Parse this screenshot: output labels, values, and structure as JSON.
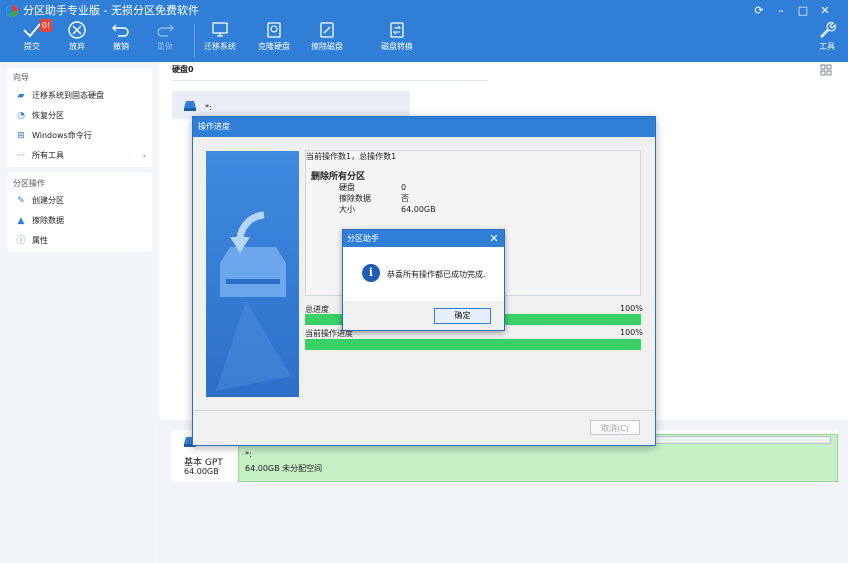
{
  "app": {
    "title": "分区助手专业版 - 无损分区免费软件",
    "window_controls": [
      "⟳",
      "–",
      "□",
      "✕"
    ]
  },
  "toolbar": {
    "pending_count": "0!",
    "buttons": [
      {
        "label": "提交",
        "icon": "check-icon",
        "enabled": true
      },
      {
        "label": "放弃",
        "icon": "discard-icon",
        "enabled": true
      },
      {
        "label": "撤销",
        "icon": "undo-icon",
        "enabled": true
      },
      {
        "label": "重做",
        "icon": "redo-icon",
        "enabled": false
      },
      {
        "label": "迁移系统",
        "icon": "migrate-os-icon",
        "enabled": true
      },
      {
        "label": "克隆硬盘",
        "icon": "clone-disk-icon",
        "enabled": true
      },
      {
        "label": "擦除磁盘",
        "icon": "wipe-disk-icon",
        "enabled": true
      },
      {
        "label": "磁盘转换",
        "icon": "convert-disk-icon",
        "enabled": true
      },
      {
        "label": "工具",
        "icon": "wrench-icon",
        "enabled": true
      }
    ]
  },
  "sidebar": {
    "wizard": {
      "heading": "向导",
      "items": [
        {
          "label": "迁移系统到固态硬盘",
          "icon": "migrate-icon"
        },
        {
          "label": "恢复分区",
          "icon": "recover-icon"
        },
        {
          "label": "Windows命令行",
          "icon": "windows-icon"
        },
        {
          "label": "所有工具",
          "icon": "more-icon",
          "chevron": "›"
        }
      ]
    },
    "partition": {
      "heading": "分区操作",
      "items": [
        {
          "label": "创建分区",
          "icon": "create-partition-icon"
        },
        {
          "label": "擦除数据",
          "icon": "wipe-data-icon"
        },
        {
          "label": "属性",
          "icon": "info-icon"
        }
      ]
    }
  },
  "main": {
    "disk_label": "硬盘0",
    "disk_card_label": "*:",
    "disk_map": {
      "type": "基本 GPT",
      "size": "64.00GB",
      "partition_label": "*:",
      "partition_desc": "64.00GB 未分配空间"
    }
  },
  "progress_dialog": {
    "title": "操作进度",
    "log": {
      "summary": "当前操作数1，总操作数1",
      "operation": "删除所有分区",
      "rows": [
        {
          "key": "硬盘",
          "value": "0"
        },
        {
          "key": "擦除数据",
          "value": "否"
        },
        {
          "key": "大小",
          "value": "64.00GB"
        }
      ]
    },
    "total_label": "总进度",
    "total_percent": "100%",
    "total_value": 1.0,
    "current_label": "当前操作进度",
    "current_percent": "100%",
    "current_value": 1.0,
    "cancel_label": "取消(C)"
  },
  "message_box": {
    "title": "分区助手",
    "close": "✕",
    "icon": "i",
    "text": "恭喜所有操作都已成功完成.",
    "ok_label": "确定"
  },
  "colors": {
    "accent": "#2f7fd6",
    "progress": "#39d066",
    "partition": "#c6f1c7"
  }
}
